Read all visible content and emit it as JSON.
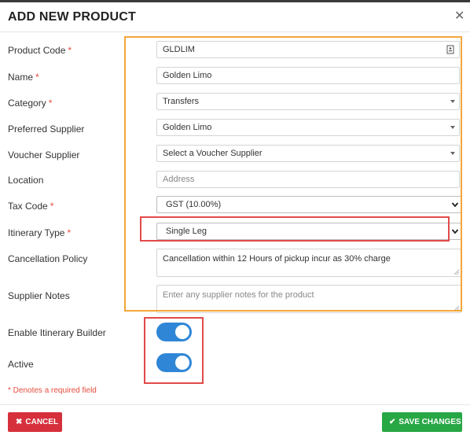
{
  "dialog": {
    "title": "ADD NEW PRODUCT",
    "close_icon": "close-icon"
  },
  "fields": {
    "product_code": {
      "label": "Product Code",
      "value": "GLDLIM",
      "required": "*"
    },
    "name": {
      "label": "Name",
      "value": "Golden Limo",
      "required": "*"
    },
    "category": {
      "label": "Category",
      "value": "Transfers",
      "required": "*"
    },
    "preferred_supplier": {
      "label": "Preferred Supplier",
      "value": "Golden Limo"
    },
    "voucher_supplier": {
      "label": "Voucher Supplier",
      "value": "Select a Voucher Supplier"
    },
    "location": {
      "label": "Location",
      "placeholder": "Address"
    },
    "tax_code": {
      "label": "Tax Code",
      "value": "GST (10.00%)",
      "required": "*"
    },
    "itinerary_type": {
      "label": "Itinerary Type",
      "value": "Single Leg",
      "required": "*"
    },
    "cancellation_policy": {
      "label": "Cancellation Policy",
      "value": "Cancellation within 12 Hours of pickup incur as 30% charge"
    },
    "supplier_notes": {
      "label": "Supplier Notes",
      "placeholder": "Enter any supplier notes for the product"
    }
  },
  "toggles": {
    "enable_itinerary_builder": {
      "label": "Enable Itinerary Builder",
      "on": true
    },
    "active": {
      "label": "Active",
      "on": true
    }
  },
  "required_note": "* Denotes a required field",
  "footer": {
    "cancel_label": "CANCEL",
    "save_label": "SAVE CHANGES"
  },
  "colors": {
    "toggle_on": "#2f86d6",
    "cancel": "#d6303c",
    "save": "#28a745",
    "highlight_orange": "#f2a63a",
    "highlight_red": "#e24a4a"
  }
}
